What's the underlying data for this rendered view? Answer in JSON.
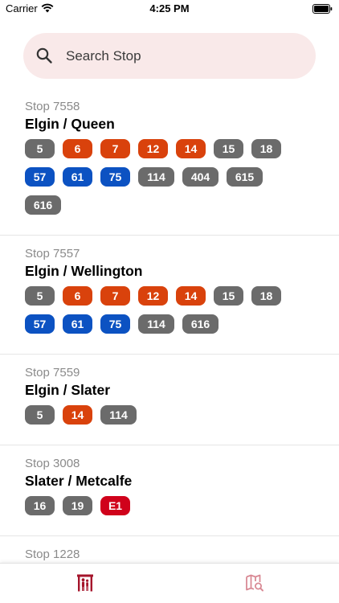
{
  "status_bar": {
    "carrier": "Carrier",
    "time": "4:25 PM"
  },
  "search": {
    "placeholder": "Search Stop"
  },
  "colors": {
    "accent": "#a5152b",
    "grey": "#6b6b6b",
    "orange": "#d9420c",
    "blue": "#0c52c2",
    "red": "#d0021b",
    "search_bg": "#f9e9e9"
  },
  "stops": [
    {
      "code": "Stop 7558",
      "name": "Elgin / Queen",
      "routes": [
        {
          "n": "5",
          "c": "grey"
        },
        {
          "n": "6",
          "c": "orange"
        },
        {
          "n": "7",
          "c": "orange"
        },
        {
          "n": "12",
          "c": "orange"
        },
        {
          "n": "14",
          "c": "orange"
        },
        {
          "n": "15",
          "c": "grey"
        },
        {
          "n": "18",
          "c": "grey"
        },
        {
          "n": "57",
          "c": "blue"
        },
        {
          "n": "61",
          "c": "blue"
        },
        {
          "n": "75",
          "c": "blue"
        },
        {
          "n": "114",
          "c": "grey"
        },
        {
          "n": "404",
          "c": "grey"
        },
        {
          "n": "615",
          "c": "grey"
        },
        {
          "n": "616",
          "c": "grey"
        }
      ]
    },
    {
      "code": "Stop 7557",
      "name": "Elgin / Wellington",
      "routes": [
        {
          "n": "5",
          "c": "grey"
        },
        {
          "n": "6",
          "c": "orange"
        },
        {
          "n": "7",
          "c": "orange"
        },
        {
          "n": "12",
          "c": "orange"
        },
        {
          "n": "14",
          "c": "orange"
        },
        {
          "n": "15",
          "c": "grey"
        },
        {
          "n": "18",
          "c": "grey"
        },
        {
          "n": "57",
          "c": "blue"
        },
        {
          "n": "61",
          "c": "blue"
        },
        {
          "n": "75",
          "c": "blue"
        },
        {
          "n": "114",
          "c": "grey"
        },
        {
          "n": "616",
          "c": "grey"
        }
      ]
    },
    {
      "code": "Stop 7559",
      "name": "Elgin / Slater",
      "routes": [
        {
          "n": "5",
          "c": "grey"
        },
        {
          "n": "14",
          "c": "orange"
        },
        {
          "n": "114",
          "c": "grey"
        }
      ]
    },
    {
      "code": "Stop 3008",
      "name": "Slater / Metcalfe",
      "routes": [
        {
          "n": "16",
          "c": "grey"
        },
        {
          "n": "19",
          "c": "grey"
        },
        {
          "n": "E1",
          "c": "red"
        }
      ]
    },
    {
      "code": "Stop 1228",
      "name": "",
      "routes": []
    }
  ],
  "tabs": [
    {
      "icon": "bus-stop-icon",
      "selected": true
    },
    {
      "icon": "map-search-icon",
      "selected": false
    }
  ]
}
